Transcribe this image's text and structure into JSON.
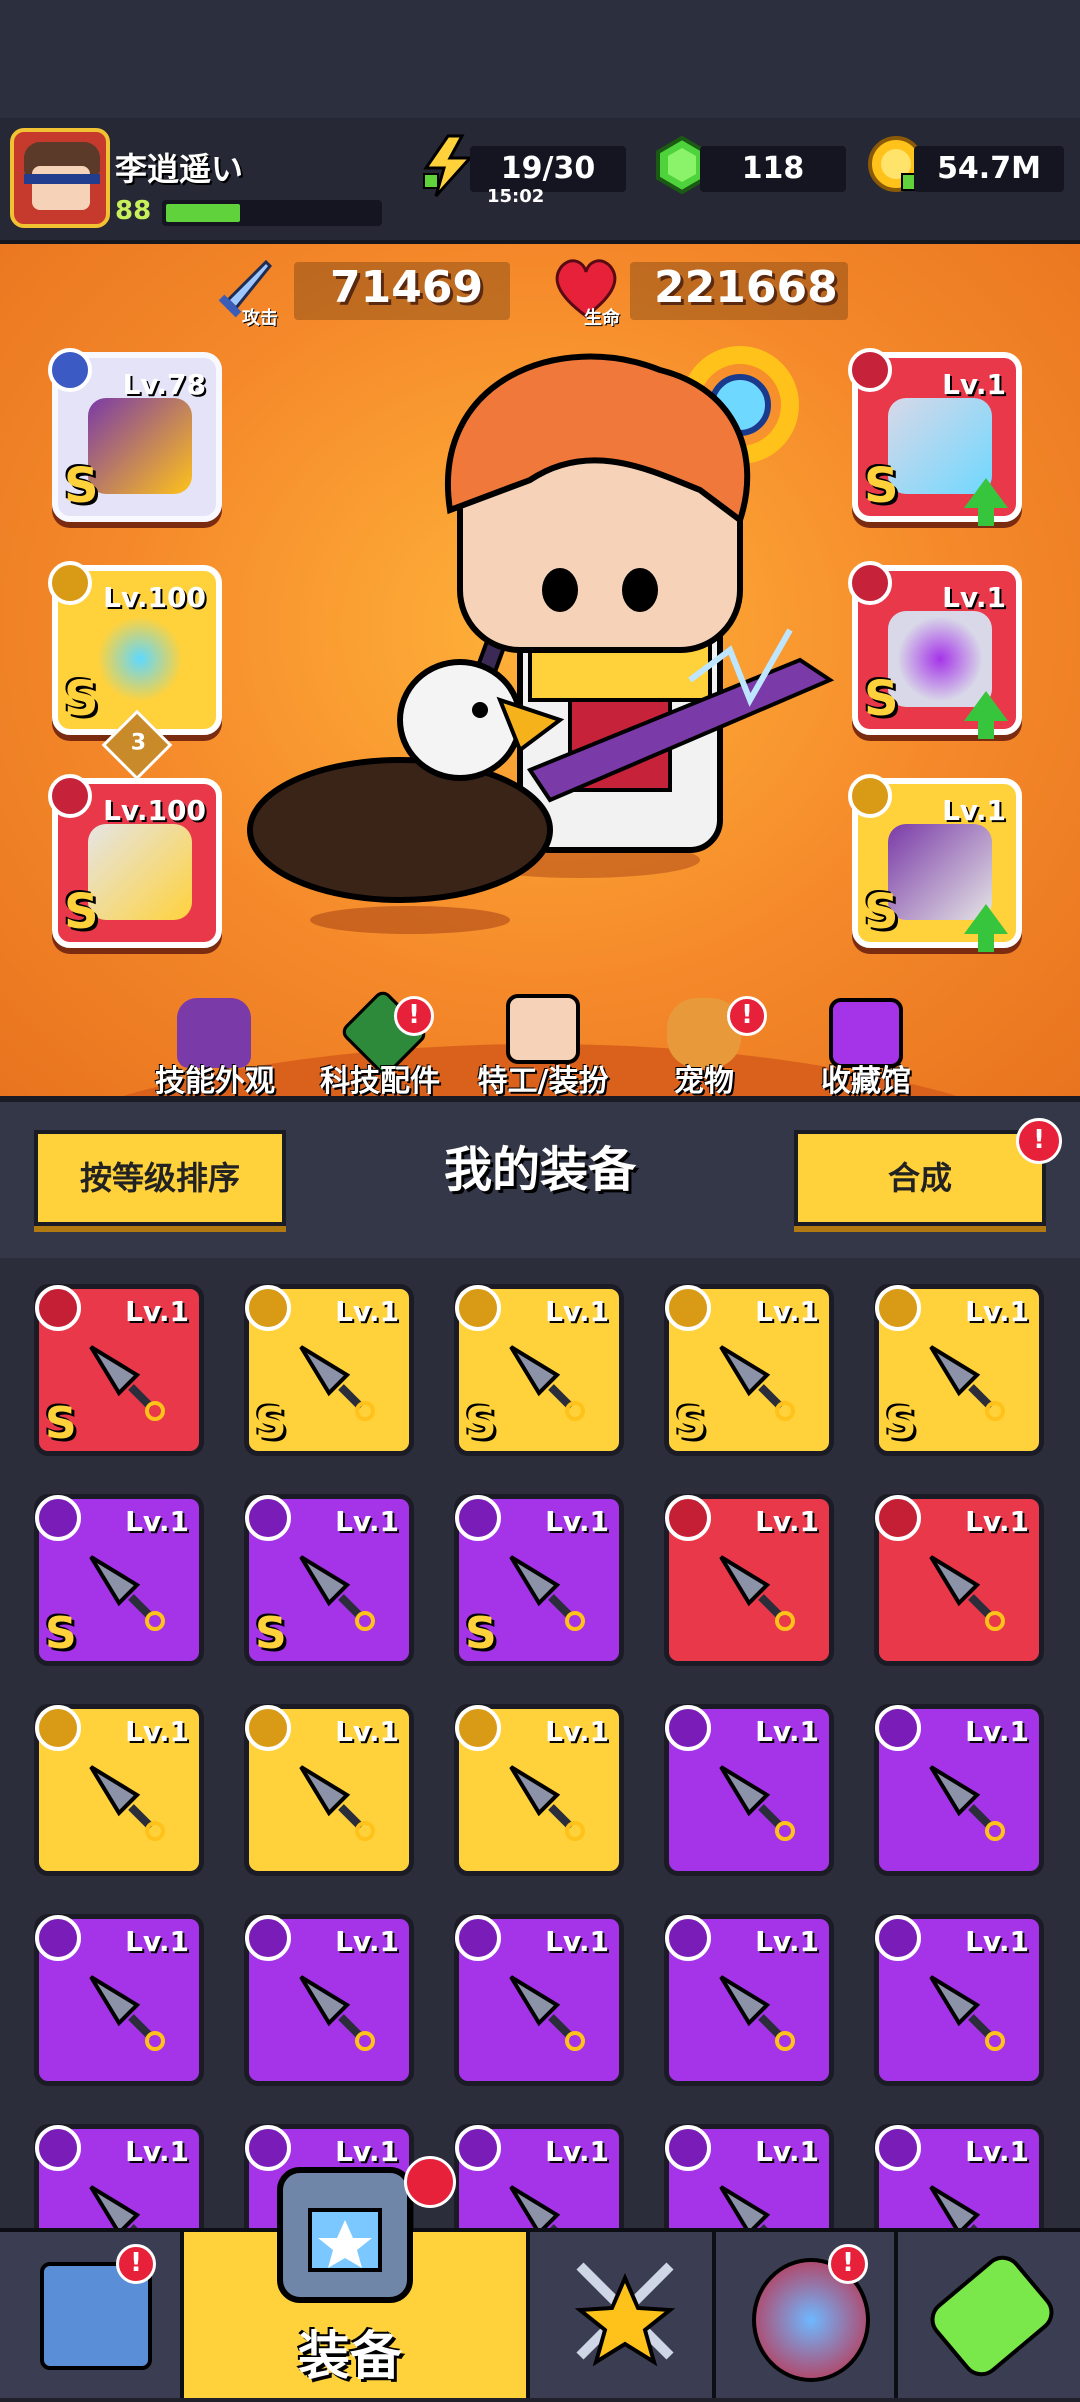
{
  "player": {
    "name": "李逍遥い",
    "level": "88",
    "xp_fraction": 0.35
  },
  "resources": {
    "energy": {
      "value": "19/30",
      "timer": "15:02",
      "icon": "lightning-icon"
    },
    "gems": {
      "value": "118",
      "icon": "green-gem-icon"
    },
    "coins": {
      "value": "54.7M",
      "icon": "gold-coin-icon"
    }
  },
  "stats": {
    "attack": {
      "label": "攻击",
      "value": "71469"
    },
    "hp": {
      "label": "生命",
      "value": "221668"
    }
  },
  "equipped": {
    "left": [
      {
        "level": "Lv.78",
        "rank": "S",
        "slot": "weapon",
        "rarity": "silver"
      },
      {
        "level": "Lv.100",
        "rank": "S",
        "slot": "necklace",
        "rarity": "gold",
        "stars": "3"
      },
      {
        "level": "Lv.100",
        "rank": "S",
        "slot": "gloves",
        "rarity": "red"
      }
    ],
    "right": [
      {
        "level": "Lv.1",
        "rank": "S",
        "slot": "armor",
        "rarity": "red"
      },
      {
        "level": "Lv.1",
        "rank": "S",
        "slot": "belt",
        "rarity": "red"
      },
      {
        "level": "Lv.1",
        "rank": "S",
        "slot": "boots",
        "rarity": "gold"
      }
    ]
  },
  "menu": [
    {
      "label": "技能外观",
      "icon": "skill-hat-icon",
      "alert": ""
    },
    {
      "label": "科技配件",
      "icon": "tech-chip-icon",
      "alert": "!"
    },
    {
      "label": "特工/装扮",
      "icon": "agent-costume-icon",
      "alert": ""
    },
    {
      "label": "宠物",
      "icon": "pet-dog-icon",
      "alert": "!"
    },
    {
      "label": "收藏馆",
      "icon": "collection-chest-icon",
      "alert": ""
    }
  ],
  "equipment_panel": {
    "sort_button": "按等级排序",
    "title": "我的装备",
    "merge_button": "合成",
    "merge_alert": "!"
  },
  "inventory": [
    {
      "level": "Lv.1",
      "rank": "S",
      "rarity": "red",
      "item": "armor"
    },
    {
      "level": "Lv.1",
      "rank": "S",
      "rarity": "gold",
      "item": "sword"
    },
    {
      "level": "Lv.1",
      "rank": "S",
      "rarity": "gold",
      "item": "spiked-blade"
    },
    {
      "level": "Lv.1",
      "rank": "S",
      "rarity": "gold",
      "item": "gauntlet"
    },
    {
      "level": "Lv.1",
      "rank": "S",
      "rarity": "gold",
      "item": "boots"
    },
    {
      "level": "Lv.1",
      "rank": "S",
      "rarity": "purple",
      "item": "star-necklace"
    },
    {
      "level": "Lv.1",
      "rank": "S",
      "rarity": "purple",
      "item": "gem-necklace"
    },
    {
      "level": "Lv.1",
      "rank": "S",
      "rarity": "purple",
      "item": "ruby-belt"
    },
    {
      "level": "Lv.1",
      "rank": "",
      "rarity": "red",
      "item": "kunai"
    },
    {
      "level": "Lv.1",
      "rank": "",
      "rarity": "red",
      "item": "spiked-collar"
    },
    {
      "level": "Lv.1",
      "rank": "",
      "rarity": "gold",
      "item": "star-belt"
    },
    {
      "level": "Lv.1",
      "rank": "",
      "rarity": "gold",
      "item": "buckle-belt"
    },
    {
      "level": "Lv.1",
      "rank": "",
      "rarity": "gold",
      "item": "claw-gauntlet"
    },
    {
      "level": "Lv.1",
      "rank": "",
      "rarity": "purple",
      "item": "kunai"
    },
    {
      "level": "Lv.1",
      "rank": "",
      "rarity": "purple",
      "item": "kunai"
    },
    {
      "level": "Lv.1",
      "rank": "",
      "rarity": "purple",
      "item": "kunai"
    },
    {
      "level": "Lv.1",
      "rank": "",
      "rarity": "purple",
      "item": "kunai"
    },
    {
      "level": "Lv.1",
      "rank": "",
      "rarity": "purple",
      "item": "kunai"
    },
    {
      "level": "Lv.1",
      "rank": "",
      "rarity": "purple",
      "item": "kunai"
    },
    {
      "level": "Lv.1",
      "rank": "",
      "rarity": "purple",
      "item": "kunai"
    },
    {
      "level": "Lv.1",
      "rank": "",
      "rarity": "purple",
      "item": "kunai"
    },
    {
      "level": "Lv.1",
      "rank": "",
      "rarity": "purple",
      "item": "kunai"
    },
    {
      "level": "Lv.1",
      "rank": "",
      "rarity": "purple",
      "item": "scythe"
    },
    {
      "level": "Lv.1",
      "rank": "",
      "rarity": "purple",
      "item": "scythe"
    },
    {
      "level": "Lv.1",
      "rank": "",
      "rarity": "purple",
      "item": "scythe"
    }
  ],
  "nav": {
    "shop": {
      "icon": "shop-icon",
      "alert": "!"
    },
    "equipment": {
      "label": "装备",
      "icon": "armor-icon"
    },
    "battle": {
      "icon": "crossed-swords-star-icon"
    },
    "gacha": {
      "icon": "star-egg-icon",
      "alert": "!"
    },
    "evolve": {
      "icon": "dna-capsule-icon"
    }
  },
  "colors": {
    "red": "#e8384a",
    "gold": "#ffd23c",
    "purple": "#a534e8",
    "orange": "#f5892a"
  }
}
